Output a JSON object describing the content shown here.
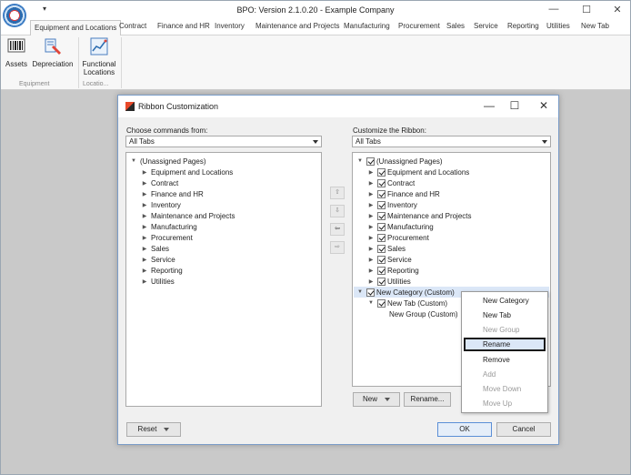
{
  "app": {
    "title": "BPO: Version 2.1.0.20 - Example Company",
    "qat_symbol": "▾",
    "window": {
      "minimize": "—",
      "maximize": "☐",
      "close": "✕"
    }
  },
  "tabs": [
    "Equipment and Locations",
    "Contract",
    "Finance and HR",
    "Inventory",
    "Maintenance and Projects",
    "Manufacturing",
    "Procurement",
    "Sales",
    "Service",
    "Reporting",
    "Utilities",
    "New Tab"
  ],
  "ribbon": {
    "buttons": [
      "Assets",
      "Depreciation",
      "Functional",
      "Locations"
    ],
    "groups": [
      "Equipment",
      "Locatio..."
    ]
  },
  "dialog": {
    "title": "Ribbon Customization",
    "left_label": "Choose commands from:",
    "right_label": "Customize the Ribbon:",
    "left_combo": "All Tabs",
    "right_combo": "All Tabs",
    "left_items": [
      "(Unassigned Pages)",
      "Equipment and Locations",
      "Contract",
      "Finance and HR",
      "Inventory",
      "Maintenance and Projects",
      "Manufacturing",
      "Procurement",
      "Sales",
      "Service",
      "Reporting",
      "Utilities"
    ],
    "right_items": [
      "(Unassigned Pages)",
      "Equipment and Locations",
      "Contract",
      "Finance and HR",
      "Inventory",
      "Maintenance and Projects",
      "Manufacturing",
      "Procurement",
      "Sales",
      "Service",
      "Reporting",
      "Utilities",
      "New Category (Custom)",
      "New Tab (Custom)",
      "New Group (Custom)"
    ],
    "new_button": "New",
    "rename_button": "Rename...",
    "reset_button": "Reset",
    "ok_button": "OK",
    "cancel_button": "Cancel",
    "move_icons": {
      "up": "⇧",
      "down": "⇩",
      "left": "⇦",
      "right": "⇨"
    },
    "window": {
      "minimize": "—",
      "maximize": "☐",
      "close": "✕"
    }
  },
  "context_menu": {
    "items": [
      {
        "label": "New Category",
        "enabled": true
      },
      {
        "label": "New Tab",
        "enabled": true
      },
      {
        "label": "New Group",
        "enabled": false
      },
      {
        "label": "Rename",
        "enabled": true,
        "highlighted": true
      },
      {
        "label": "Remove",
        "enabled": true
      },
      {
        "label": "Add",
        "enabled": false
      },
      {
        "label": "Move Down",
        "enabled": false
      },
      {
        "label": "Move Up",
        "enabled": false
      }
    ]
  }
}
